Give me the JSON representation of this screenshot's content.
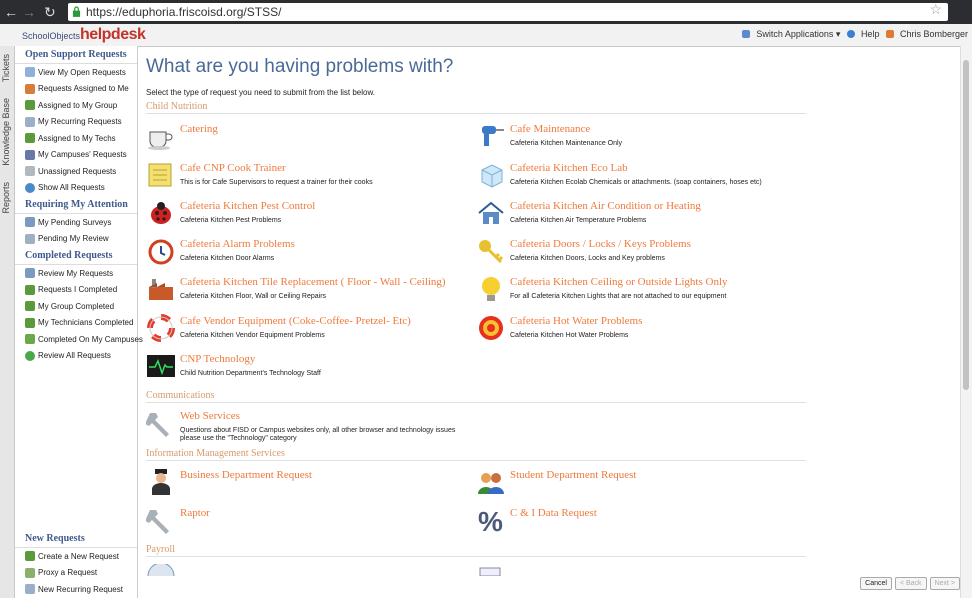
{
  "browser": {
    "url": "https://eduphoria.friscoisd.org/STSS/"
  },
  "header": {
    "logo_small": "SchoolObjects",
    "logo_big": "helpdesk",
    "switch_label": "Switch Applications ▾",
    "help_label": "Help",
    "user_label": "Chris Bomberger"
  },
  "vtabs": [
    "Tickets",
    "Knowledge Base",
    "Reports"
  ],
  "sidebar": {
    "open_title": "Open Support Requests",
    "open_items": [
      "View My Open Requests",
      "Requests Assigned to Me",
      "Assigned to My Group",
      "My Recurring Requests",
      "Assigned to My Techs",
      "My Campuses' Requests",
      "Unassigned Requests",
      "Show All Requests"
    ],
    "attention_title": "Requiring My Attention",
    "attention_items": [
      "My Pending Surveys",
      "Pending My Review"
    ],
    "completed_title": "Completed Requests",
    "completed_items": [
      "Review My Requests",
      "Requests I Completed",
      "My Group Completed",
      "My Technicians Completed",
      "Completed On My Campuses",
      "Review All Requests"
    ],
    "new_title": "New Requests",
    "new_items": [
      "Create a New Request",
      "Proxy a Request",
      "New Recurring Request"
    ]
  },
  "main": {
    "title": "What are you having problems with?",
    "subtitle": "Select the type of request you need to submit from the list below.",
    "cat_child": "Child Nutrition",
    "cat_comm": "Communications",
    "cat_ims": "Information Management Services",
    "cat_payroll": "Payroll",
    "opts": {
      "catering": {
        "title": "Catering",
        "desc": ""
      },
      "cafe_maint": {
        "title": "Cafe Maintenance",
        "desc": "Cafeteria Kitchen Maintenance Only"
      },
      "cook": {
        "title": "Cafe CNP Cook Trainer",
        "desc": "This is for Cafe Supervisors to request a trainer for their cooks"
      },
      "ecolab": {
        "title": "Cafeteria Kitchen Eco Lab",
        "desc": "Cafeteria Kitchen Ecolab Chemicals or attachments. (soap containers, hoses etc)"
      },
      "pest": {
        "title": "Cafeteria Kitchen Pest Control",
        "desc": "Cafeteria Kitchen Pest Problems"
      },
      "aircon": {
        "title": "Cafeteria Kitchen Air Condition or Heating",
        "desc": "Cafeteria Kitchen Air Temperature Problems"
      },
      "alarm": {
        "title": "Cafeteria Alarm Problems",
        "desc": "Cafeteria Kitchen Door Alarms"
      },
      "doors": {
        "title": "Cafeteria Doors / Locks / Keys Problems",
        "desc": "Cafeteria Kitchen Doors, Locks and Key problems"
      },
      "tile": {
        "title": "Cafeteria Kitchen Tile Replacement ( Floor - Wall - Ceiling)",
        "desc": "Cafeteria Kitchen Floor, Wall or Ceiling Repairs"
      },
      "lights": {
        "title": "Cafeteria Kitchen Ceiling or Outside Lights Only",
        "desc": "For all Cafeteria Kitchen Lights that are not attached to our equipment"
      },
      "vendor": {
        "title": "Cafe Vendor Equipment (Coke-Coffee- Pretzel- Etc)",
        "desc": "Cafeteria Kitchen Vendor Equipment Problems"
      },
      "hotwater": {
        "title": "Cafeteria Hot Water Problems",
        "desc": "Cafeteria Kitchen Hot Water Problems"
      },
      "cnptech": {
        "title": "CNP Technology",
        "desc": "Child Nutrition Department's Technology Staff"
      },
      "web": {
        "title": "Web Services",
        "desc": "Questions about FISD or Campus websites only, all other browser and technology issues",
        "desc2": "please use the \"Technology\" category"
      },
      "business": {
        "title": "Business Department Request",
        "desc": ""
      },
      "student": {
        "title": "Student Department Request",
        "desc": ""
      },
      "raptor": {
        "title": "Raptor",
        "desc": ""
      },
      "cidata": {
        "title": "C & I Data Request",
        "desc": ""
      }
    }
  },
  "footer": {
    "cancel": "Cancel",
    "back": "< Back",
    "next": "Next >"
  }
}
